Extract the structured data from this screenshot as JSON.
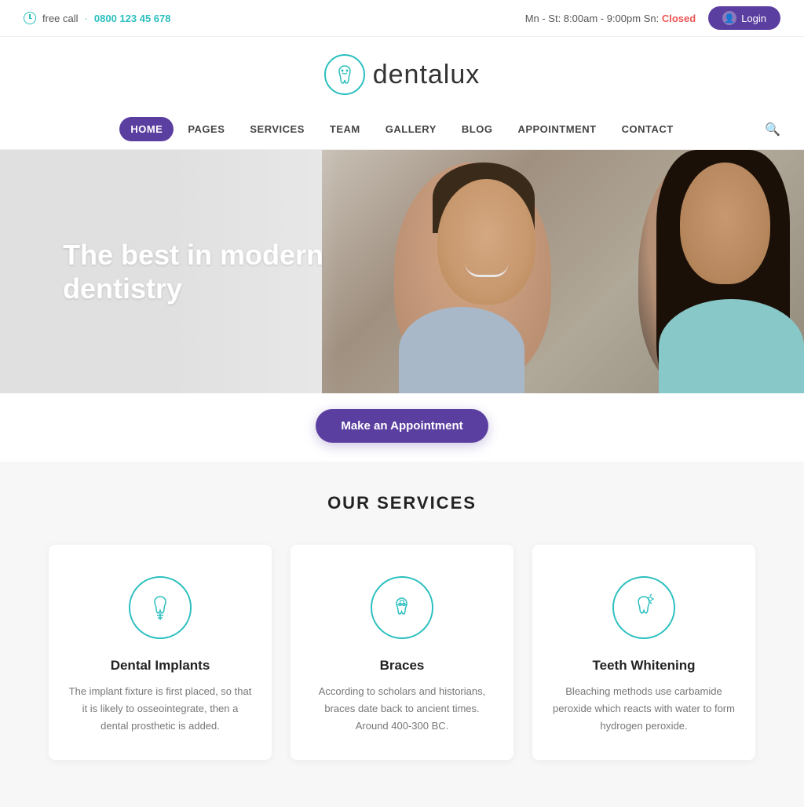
{
  "topbar": {
    "free_call_label": "free call",
    "separator": "·",
    "phone": "0800 123 45 678",
    "hours": "Mn - St: 8:00am - 9:00pm Sn:",
    "closed_label": "Closed",
    "login_label": "Login"
  },
  "logo": {
    "text": "dentalux"
  },
  "nav": {
    "items": [
      {
        "label": "HOME",
        "active": true
      },
      {
        "label": "PAGES",
        "active": false
      },
      {
        "label": "SERVICES",
        "active": false
      },
      {
        "label": "TEAM",
        "active": false
      },
      {
        "label": "GALLERY",
        "active": false
      },
      {
        "label": "BLOG",
        "active": false
      },
      {
        "label": "APPOINTMENT",
        "active": false
      },
      {
        "label": "CONTACT",
        "active": false
      }
    ],
    "search_label": "search"
  },
  "hero": {
    "title": "The best in modern dentistry",
    "appointment_button": "Make an Appointment"
  },
  "services": {
    "section_title": "OUR SERVICES",
    "cards": [
      {
        "icon": "tooth-implant",
        "name": "Dental Implants",
        "description": "The implant fixture is first placed, so that it is likely to osseointegrate, then a dental prosthetic is added."
      },
      {
        "icon": "braces",
        "name": "Braces",
        "description": "According to scholars and historians, braces date back to ancient times. Around 400-300 BC."
      },
      {
        "icon": "teeth-whitening",
        "name": "Teeth Whitening",
        "description": "Bleaching methods use carbamide peroxide which reacts with water to form hydrogen peroxide."
      }
    ]
  },
  "colors": {
    "teal": "#2bbfbf",
    "purple": "#5b3fa0",
    "dark_text": "#222222",
    "light_text": "#777777"
  }
}
